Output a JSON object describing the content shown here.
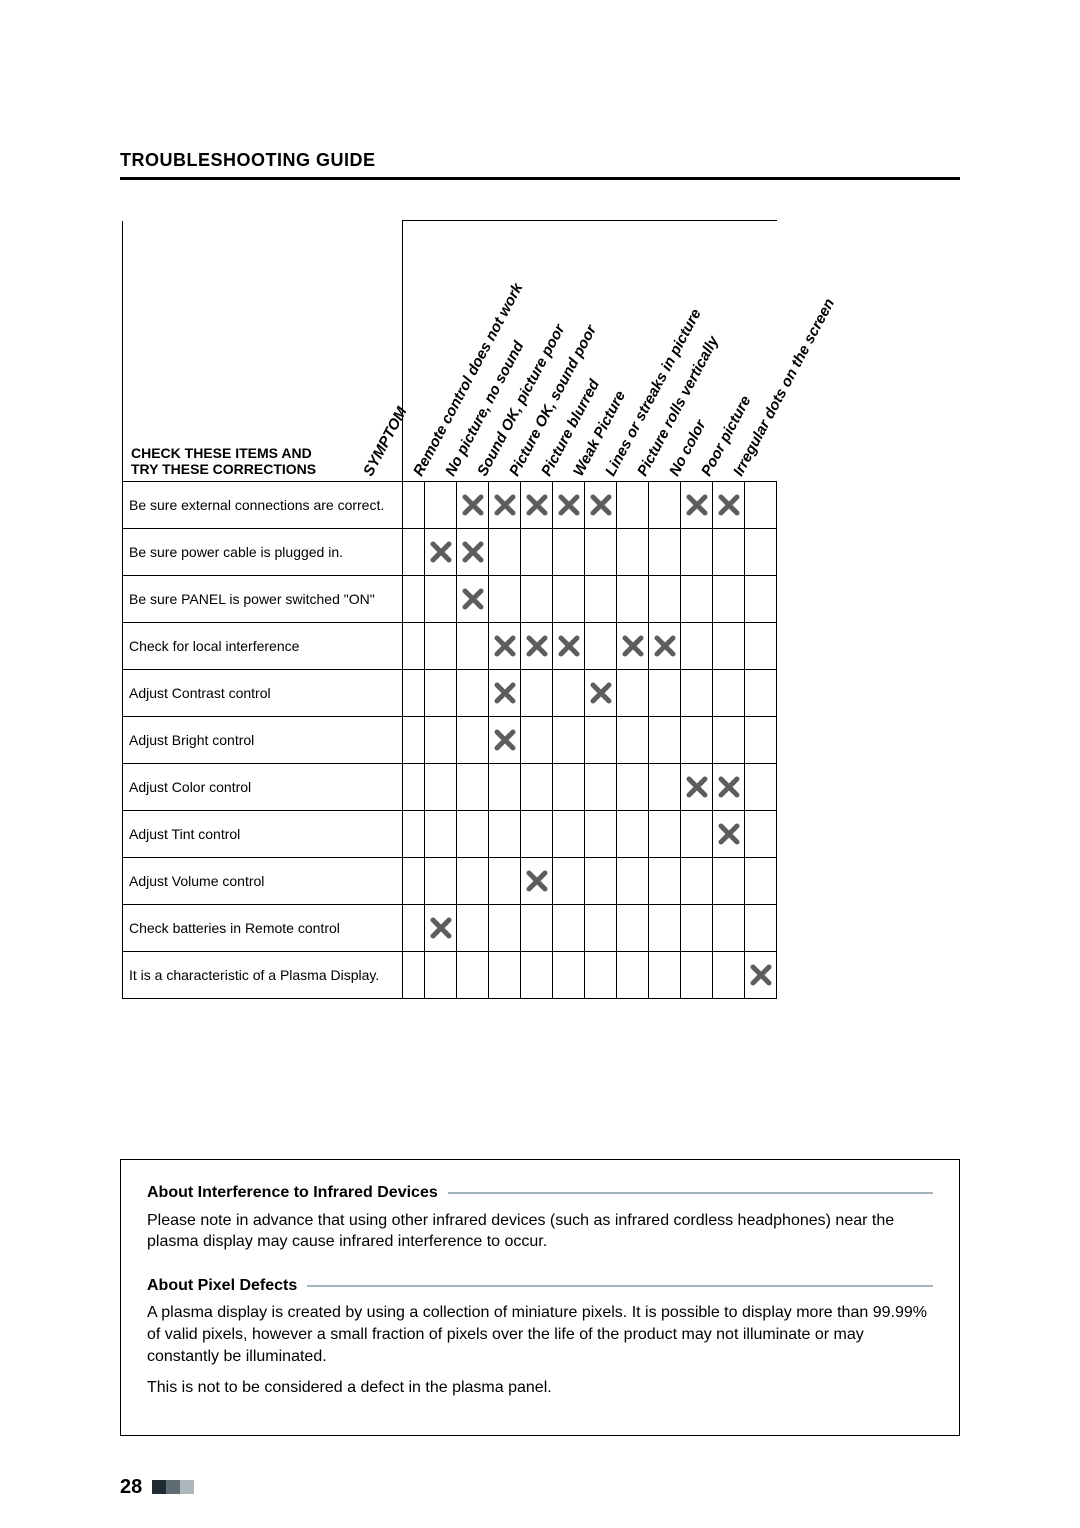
{
  "section_title": "TROUBLESHOOTING GUIDE",
  "header_stub_line1": "CHECK THESE ITEMS AND",
  "header_stub_line2": "TRY THESE CORRECTIONS",
  "symptom_word": "SYMPTOM",
  "symptoms": [
    "Remote control does not work",
    "No picture, no sound",
    "Sound OK, picture poor",
    "Picture OK, sound poor",
    "Picture blurred",
    "Weak Picture",
    "Lines or streaks in picture",
    "Picture rolls vertically",
    "No color",
    "Poor picture",
    "Irregular dots on the screen"
  ],
  "corrections": [
    "Be sure external connections are correct.",
    "Be sure power cable is plugged in.",
    "Be sure PANEL is power switched \"ON\"",
    "Check for local interference",
    "Adjust Contrast control",
    "Adjust Bright control",
    "Adjust Color control",
    "Adjust Tint control",
    "Adjust Volume control",
    "Check batteries in Remote control",
    "It is a characteristic of a Plasma Display."
  ],
  "chart_data": {
    "type": "table",
    "title": "Troubleshooting — symptoms × corrections (X = applies)",
    "columns": [
      "Remote control does not work",
      "No picture, no sound",
      "Sound OK, picture poor",
      "Picture OK, sound poor",
      "Picture blurred",
      "Weak Picture",
      "Lines or streaks in picture",
      "Picture rolls vertically",
      "No color",
      "Poor picture",
      "Irregular dots on the screen"
    ],
    "rows": [
      "Be sure external connections are correct.",
      "Be sure power cable is plugged in.",
      "Be sure PANEL is power switched \"ON\"",
      "Check for local interference",
      "Adjust Contrast control",
      "Adjust Bright control",
      "Adjust Color control",
      "Adjust Tint control",
      "Adjust Volume control",
      "Check batteries in Remote control",
      "It is a characteristic of a Plasma Display."
    ],
    "matrix": [
      [
        0,
        1,
        1,
        1,
        1,
        1,
        0,
        0,
        1,
        1,
        0
      ],
      [
        1,
        1,
        0,
        0,
        0,
        0,
        0,
        0,
        0,
        0,
        0
      ],
      [
        0,
        1,
        0,
        0,
        0,
        0,
        0,
        0,
        0,
        0,
        0
      ],
      [
        0,
        0,
        1,
        1,
        1,
        0,
        1,
        1,
        0,
        0,
        0
      ],
      [
        0,
        0,
        1,
        0,
        0,
        1,
        0,
        0,
        0,
        0,
        0
      ],
      [
        0,
        0,
        1,
        0,
        0,
        0,
        0,
        0,
        0,
        0,
        0
      ],
      [
        0,
        0,
        0,
        0,
        0,
        0,
        0,
        0,
        1,
        1,
        0
      ],
      [
        0,
        0,
        0,
        0,
        0,
        0,
        0,
        0,
        0,
        1,
        0
      ],
      [
        0,
        0,
        0,
        1,
        0,
        0,
        0,
        0,
        0,
        0,
        0
      ],
      [
        1,
        0,
        0,
        0,
        0,
        0,
        0,
        0,
        0,
        0,
        0
      ],
      [
        0,
        0,
        0,
        0,
        0,
        0,
        0,
        0,
        0,
        0,
        1
      ]
    ]
  },
  "footnote": {
    "h1": "About Interference to Infrared Devices",
    "p1": "Please note in advance that using other infrared devices (such as infrared cordless headphones) near the plasma display may cause infrared interference to occur.",
    "h2": "About Pixel Defects",
    "p2": "A plasma display is created by using a collection of miniature pixels. It is possible to display more than 99.99% of valid pixels, however a small fraction of pixels over the life of the product may not illuminate or may constantly be illuminated.",
    "p3": "This is not to be considered a defect in the plasma panel."
  },
  "page_number": "28"
}
